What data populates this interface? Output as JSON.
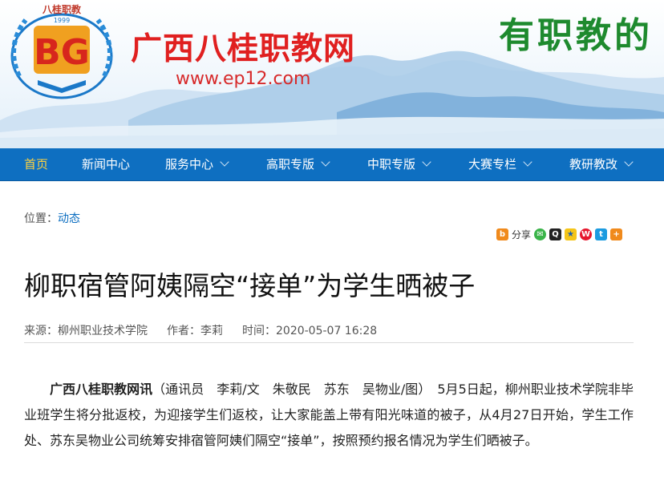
{
  "header": {
    "logo_top_text": "八桂职教",
    "logo_year": "1999",
    "logo_mark": "BG",
    "site_title": "广西八桂职教网",
    "site_url": "www.ep12.com",
    "slogan": "有职教的"
  },
  "nav": {
    "items": [
      {
        "label": "首页",
        "active": true,
        "has_dropdown": false
      },
      {
        "label": "新闻中心",
        "active": false,
        "has_dropdown": false
      },
      {
        "label": "服务中心",
        "active": false,
        "has_dropdown": true
      },
      {
        "label": "高职专版",
        "active": false,
        "has_dropdown": true
      },
      {
        "label": "中职专版",
        "active": false,
        "has_dropdown": true
      },
      {
        "label": "大赛专栏",
        "active": false,
        "has_dropdown": true
      },
      {
        "label": "教研教改",
        "active": false,
        "has_dropdown": true
      }
    ]
  },
  "breadcrumb": {
    "prefix": "位置：",
    "link": "动态"
  },
  "share": {
    "label": "分享",
    "icons": [
      "share-b-icon",
      "wechat-icon",
      "qq-icon",
      "qzone-icon",
      "weibo-icon",
      "tencent-icon",
      "more-icon"
    ]
  },
  "article": {
    "title": "柳职宿管阿姨隔空“接单”为学生晒被子",
    "source": "来源：柳州职业技术学院",
    "author": "作者：李莉",
    "time": "时间：2020-05-07 16:28",
    "lead": "广西八桂职教网讯",
    "body": "（通讯员　李莉/文　朱敬民　苏东　吴物业/图）　5月5日起，柳州职业技术学院非毕业班学生将分批返校，为迎接学生们返校，让大家能盖上带有阳光味道的被子，从4月27日开始，学生工作处、苏东吴物业公司统筹安排宿管阿姨们隔空“接单”，按照预约报名情况为学生们晒被子。"
  },
  "colors": {
    "nav_bg": "#0e6fc1",
    "nav_active": "#ffd23f",
    "title_red": "#e02020",
    "slogan_green": "#1e8a2e",
    "link_blue": "#0e6fc1"
  }
}
